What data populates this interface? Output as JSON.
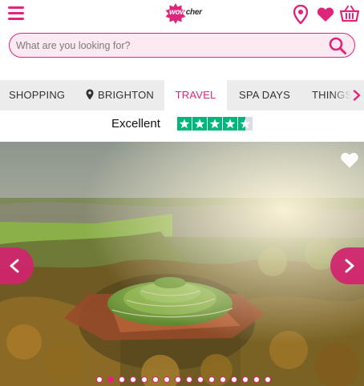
{
  "header": {
    "menu_icon": "hamburger-menu-icon",
    "logo_alt": "wowcher",
    "logo_prefix": "wow",
    "logo_suffix": "cher",
    "location_icon": "map-pin-icon",
    "favourites_icon": "heart-icon",
    "basket_icon": "shopping-basket-icon"
  },
  "search": {
    "placeholder": "What are you looking for?",
    "value": ""
  },
  "tabs": [
    {
      "label": "SHOPPING",
      "active": false
    },
    {
      "label": "BRIGHTON",
      "active": false,
      "icon": "map-pin-icon"
    },
    {
      "label": "TRAVEL",
      "active": true
    },
    {
      "label": "SPA DAYS",
      "active": false
    },
    {
      "label": "THINGS",
      "active": false
    }
  ],
  "rating": {
    "label": "Excellent",
    "stars": 4.5,
    "max_stars": 5
  },
  "carousel": {
    "image_alt": "Aerial view of a grassy mound fortress surrounded by autumn trees at sunrise",
    "slide_count": 16,
    "active_slide": 2
  },
  "colors": {
    "brand": "#e0247b",
    "search_bg": "#fde9f2",
    "tabs_bg": "#ececec",
    "trustpilot_green": "#00b67a"
  }
}
